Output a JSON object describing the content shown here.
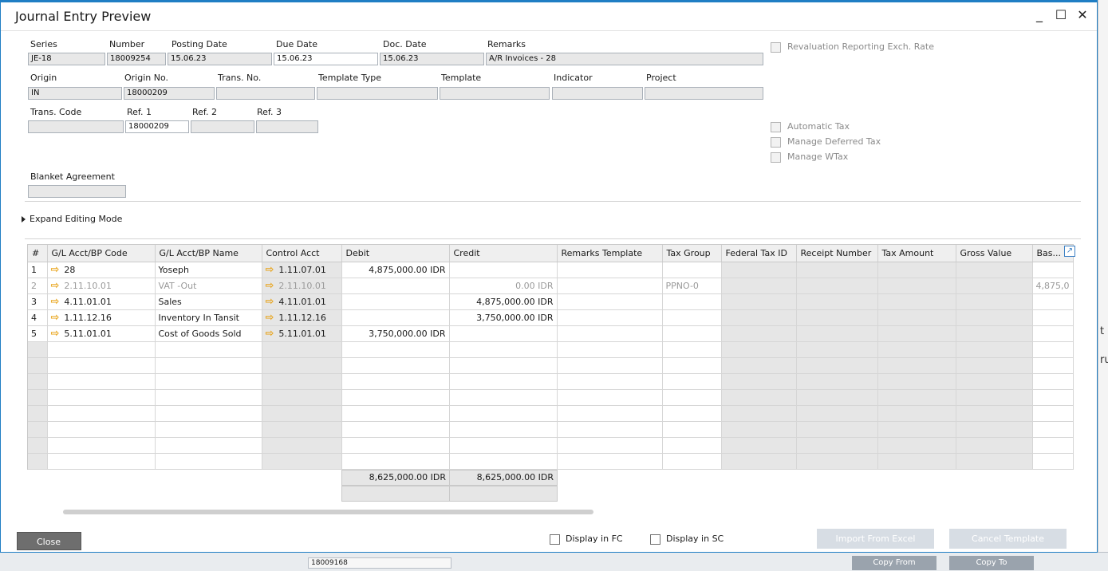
{
  "window": {
    "title": "Journal Entry Preview",
    "minimize": "_",
    "maximize": "☐",
    "close": "✕"
  },
  "header": {
    "series": {
      "label": "Series",
      "value": "JE-18"
    },
    "number": {
      "label": "Number",
      "value": "18009254"
    },
    "posting_date": {
      "label": "Posting Date",
      "value": "15.06.23"
    },
    "due_date": {
      "label": "Due Date",
      "value": "15.06.23"
    },
    "doc_date": {
      "label": "Doc. Date",
      "value": "15.06.23"
    },
    "remarks": {
      "label": "Remarks",
      "value": "A/R Invoices - 28"
    },
    "origin": {
      "label": "Origin",
      "value": "IN"
    },
    "origin_no": {
      "label": "Origin No.",
      "value": "18000209"
    },
    "trans_no": {
      "label": "Trans. No.",
      "value": ""
    },
    "template_type": {
      "label": "Template Type",
      "value": ""
    },
    "template": {
      "label": "Template",
      "value": ""
    },
    "indicator": {
      "label": "Indicator",
      "value": ""
    },
    "project": {
      "label": "Project",
      "value": ""
    },
    "trans_code": {
      "label": "Trans. Code",
      "value": ""
    },
    "ref1": {
      "label": "Ref. 1",
      "value": "18000209"
    },
    "ref2": {
      "label": "Ref. 2",
      "value": ""
    },
    "ref3": {
      "label": "Ref. 3",
      "value": ""
    },
    "blanket_agreement": {
      "label": "Blanket Agreement",
      "value": ""
    }
  },
  "checkboxes": {
    "revaluation": "Revaluation Reporting Exch. Rate",
    "automatic_tax": "Automatic Tax",
    "manage_deferred_tax": "Manage Deferred Tax",
    "manage_wtax": "Manage WTax"
  },
  "expand_editing_mode": "Expand Editing Mode",
  "grid": {
    "columns": [
      "#",
      "G/L Acct/BP Code",
      "G/L Acct/BP Name",
      "Control Acct",
      "Debit",
      "Credit",
      "Remarks Template",
      "Tax Group",
      "Federal Tax ID",
      "Receipt Number",
      "Tax Amount",
      "Gross Value",
      "Bas..."
    ],
    "rows": [
      {
        "n": "1",
        "code": "28",
        "name": "Yoseph",
        "control": "1.11.07.01",
        "debit": "4,875,000.00 IDR",
        "credit": "",
        "tax_group": "",
        "base": ""
      },
      {
        "n": "2",
        "code": "2.11.10.01",
        "name": "VAT -Out",
        "control": "2.11.10.01",
        "debit": "",
        "credit": "0.00 IDR",
        "tax_group": "PPNO-0",
        "base": "4,875,0"
      },
      {
        "n": "3",
        "code": "4.11.01.01",
        "name": "Sales",
        "control": "4.11.01.01",
        "debit": "",
        "credit": "4,875,000.00 IDR",
        "tax_group": "",
        "base": ""
      },
      {
        "n": "4",
        "code": "1.11.12.16",
        "name": "Inventory In Tansit",
        "control": "1.11.12.16",
        "debit": "",
        "credit": "3,750,000.00 IDR",
        "tax_group": "",
        "base": ""
      },
      {
        "n": "5",
        "code": "5.11.01.01",
        "name": "Cost of Goods Sold",
        "control": "5.11.01.01",
        "debit": "3,750,000.00 IDR",
        "credit": "",
        "tax_group": "",
        "base": ""
      }
    ],
    "totals": {
      "debit": "8,625,000.00 IDR",
      "credit": "8,625,000.00 IDR"
    }
  },
  "footer": {
    "close": "Close",
    "display_fc": "Display in FC",
    "display_sc": "Display in SC",
    "import_excel": "Import From Excel",
    "cancel_template": "Cancel Template"
  },
  "background": {
    "right_t1": "t",
    "right_t2": "ru",
    "bottom_field": "18009168",
    "bottom_btn1": "Copy From",
    "bottom_btn2": "Copy To"
  },
  "colors": {
    "accent": "#1f7ec4",
    "arrow": "#e8a317",
    "disabled_button": "#d7dde4"
  }
}
